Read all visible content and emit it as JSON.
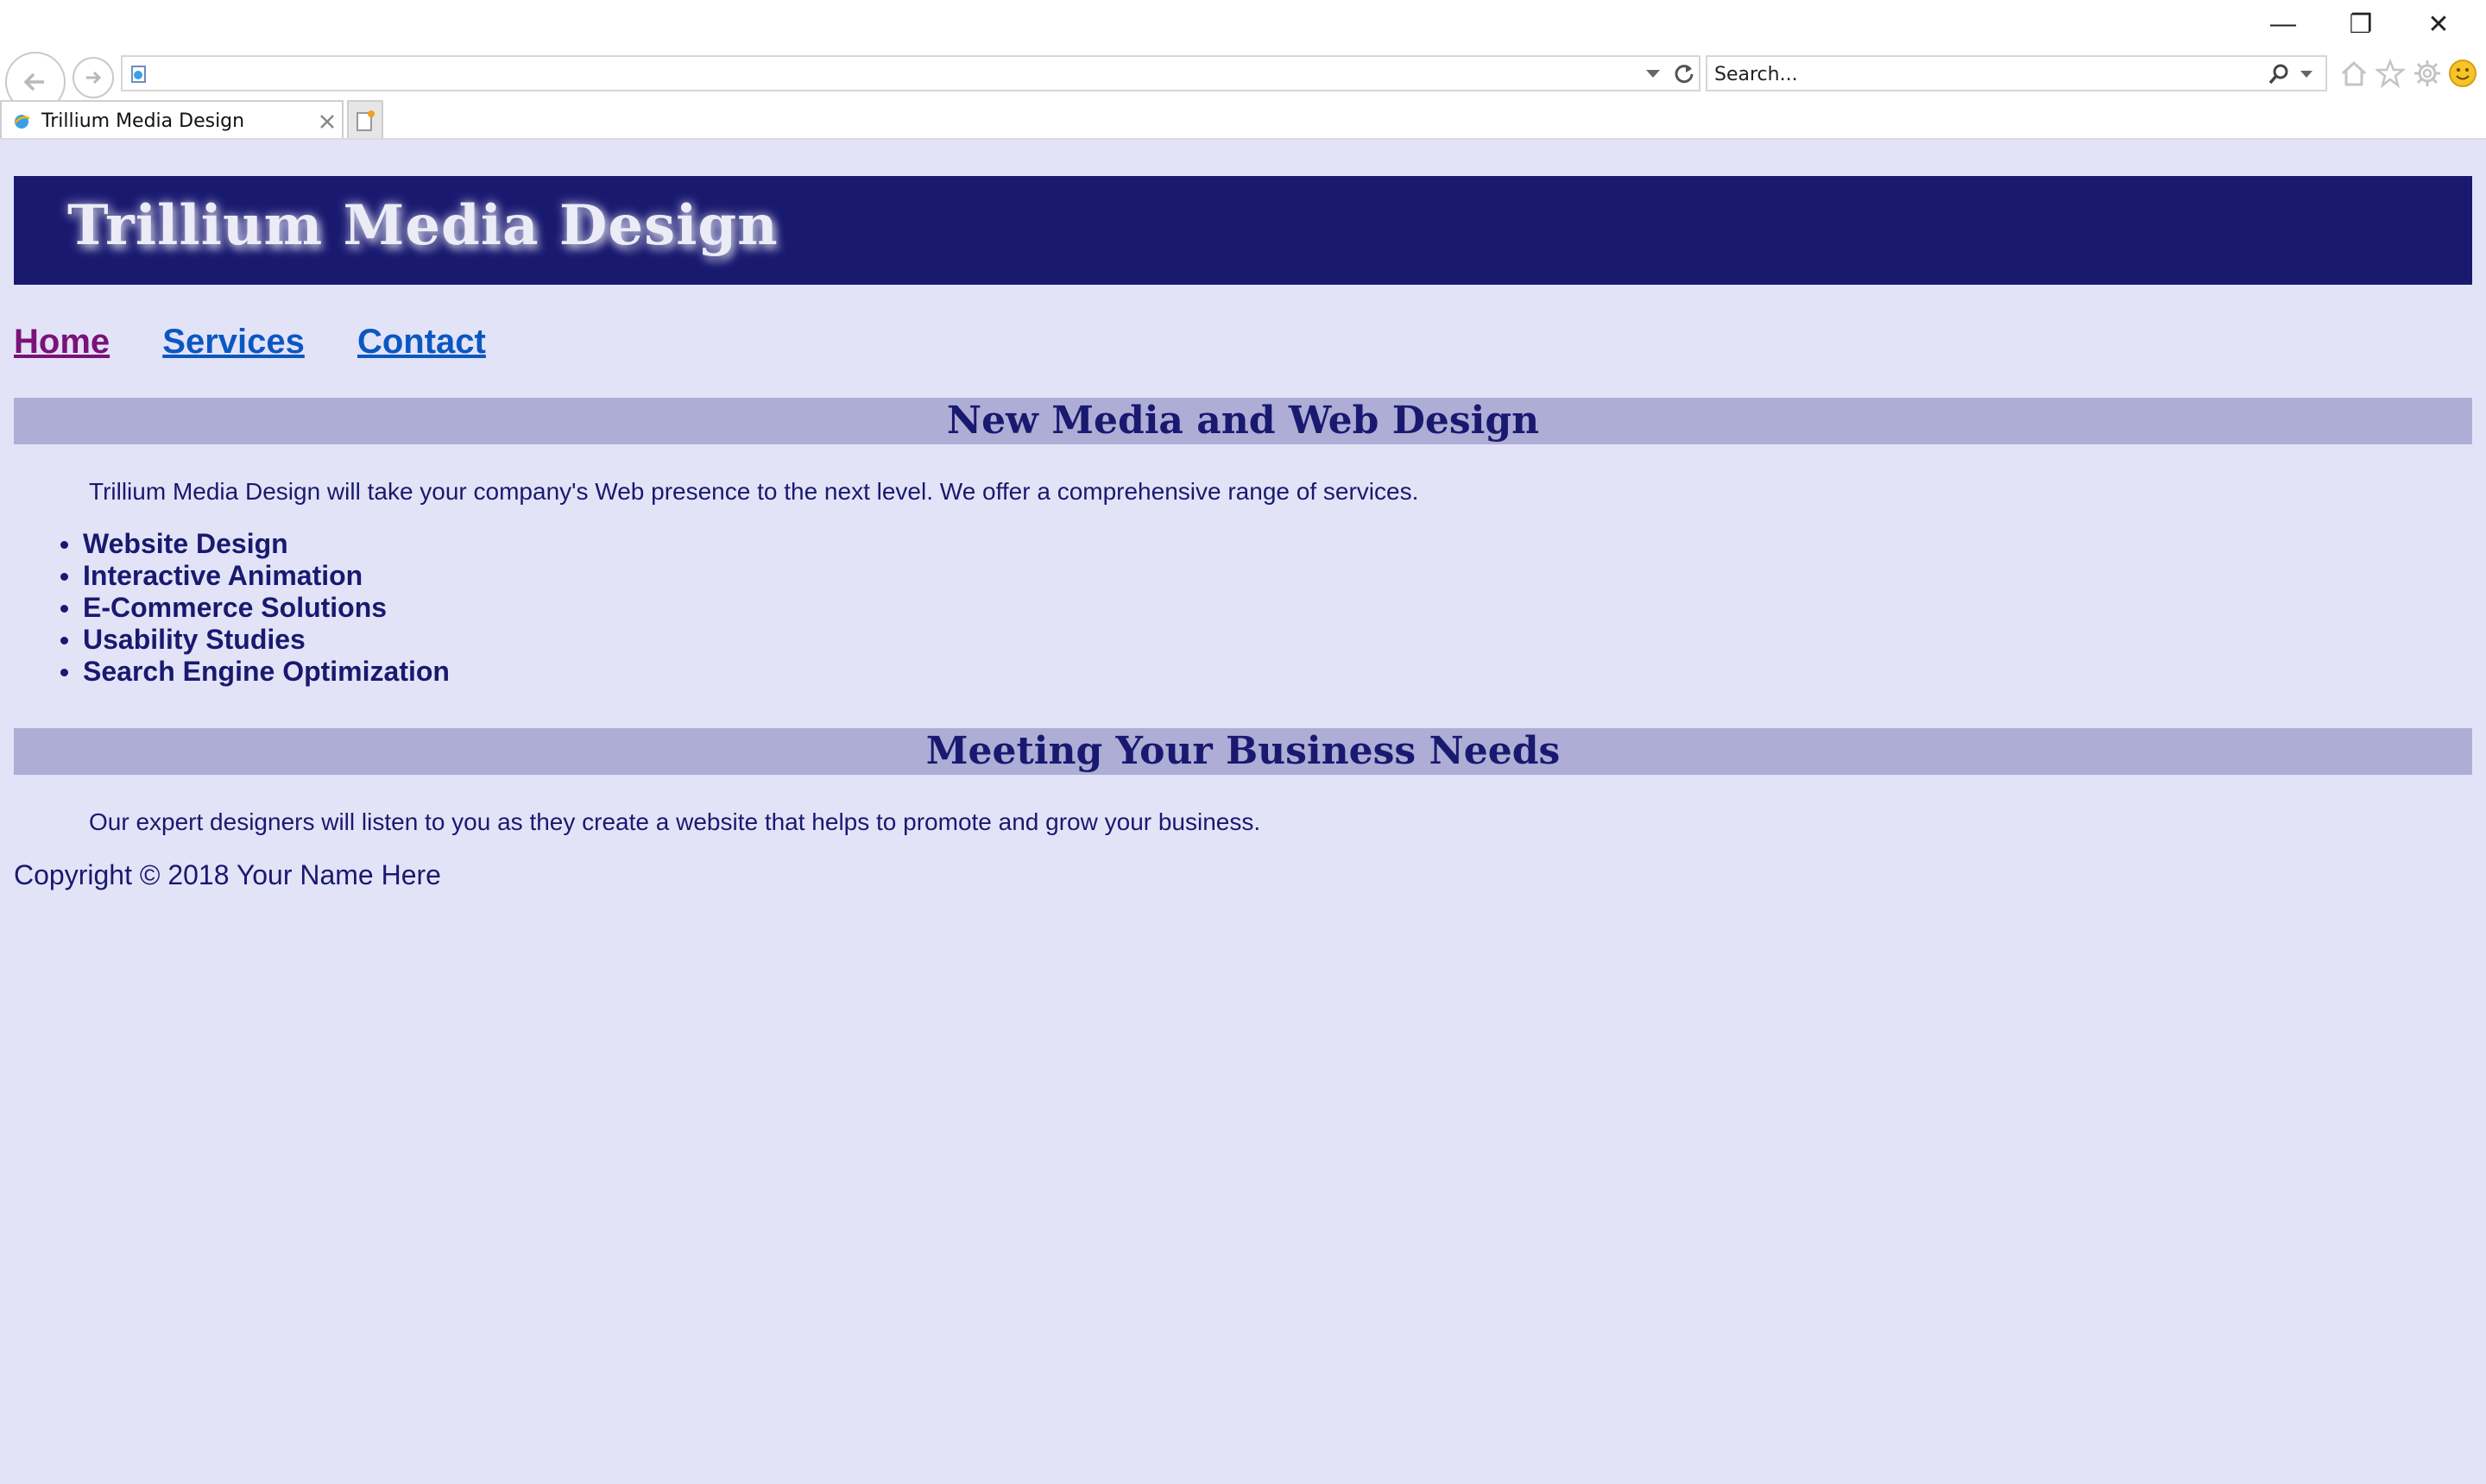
{
  "browser": {
    "window_controls": {
      "minimize": "—",
      "restore": "❐",
      "close": "✕"
    },
    "address_value": "",
    "search_placeholder": "Search...",
    "tab_title": "Trillium Media Design",
    "icons": [
      "back-icon",
      "forward-icon",
      "page-icon",
      "dropdown-icon",
      "refresh-icon",
      "search-icon",
      "home-icon",
      "favorites-star-icon",
      "gear-icon",
      "smiley-icon",
      "new-tab-icon",
      "close-tab-icon"
    ]
  },
  "site": {
    "title": "Trillium Media Design",
    "nav": [
      {
        "label": "Home"
      },
      {
        "label": "Services"
      },
      {
        "label": "Contact"
      }
    ],
    "section1": {
      "heading": "New Media and Web Design",
      "paragraph": "Trillium Media Design will take your company's Web presence to the next level. We offer a comprehensive range of services."
    },
    "services": [
      "Website Design",
      "Interactive Animation",
      "E-Commerce Solutions",
      "Usability Studies",
      "Search Engine Optimization"
    ],
    "section2": {
      "heading": "Meeting Your Business Needs",
      "paragraph": "Our expert designers will listen to you as they create a website that helps to promote and grow your business."
    },
    "footer": "Copyright © 2018 Your Name Here"
  },
  "colors": {
    "page_background": "#e3e3f8",
    "header_background": "#191970",
    "heading_background": "#adadd6",
    "text": "#191970",
    "link": "#0b57c2",
    "visited_link": "#7a1277"
  }
}
